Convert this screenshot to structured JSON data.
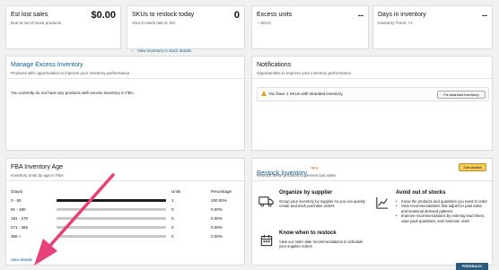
{
  "cards": {
    "lost_sales": {
      "title": "Est lost sales",
      "value": "$0.00",
      "subtitle": "Due to out of stock products"
    },
    "restock": {
      "title": "SKUs to restock today",
      "value": "0",
      "subtitle": "Your in-stock rate is: 0%",
      "link": "View inventory in stock details"
    },
    "excess": {
      "title": "Excess units",
      "value": "--",
      "subtitle": "-- SKUs"
    },
    "days": {
      "title": "Days in inventory",
      "value": "--",
      "subtitle": "Inventory Turns: <1"
    }
  },
  "excess_inventory": {
    "title": "Manage Excess Inventory",
    "subtitle": "Products with opportunities to improve your inventory performance",
    "message": "You currently do not have any products with excess inventory in FBA."
  },
  "notifications": {
    "title": "Notifications",
    "subtitle": "Opportunities to improve your inventory performance",
    "message": "You have 1 SKUs with stranded inventory.",
    "button": "Fix stranded inventory"
  },
  "age": {
    "title": "FBA Inventory Age",
    "subtitle": "Inventory units by age in FBA",
    "headers": {
      "days": "(Days)",
      "units": "Units",
      "pct": "Percentage"
    },
    "rows": [
      {
        "range": "0 - 90",
        "units": "1",
        "pct": "100.00%",
        "fill": 1.0
      },
      {
        "range": "91 - 180",
        "units": "0",
        "pct": "0.00%",
        "fill": 0
      },
      {
        "range": "181 - 270",
        "units": "0",
        "pct": "0.00%",
        "fill": 0
      },
      {
        "range": "271 - 365",
        "units": "0",
        "pct": "0.00%",
        "fill": 0
      },
      {
        "range": "365 +",
        "units": "0",
        "pct": "0.00%",
        "fill": 0
      }
    ],
    "link": "View details"
  },
  "restock_inventory": {
    "title": "Restock Inventory",
    "badge": "NEW",
    "subtitle": "Restock these products to prevent lost sales",
    "button": "Get started",
    "organize": {
      "title": "Organize by supplier",
      "text": "Group your inventory by supplier so you can quickly create and track purchase orders"
    },
    "when": {
      "title": "Know when to restock",
      "text": "View our order date recommendations to schedule your supplier orders"
    },
    "avoid": {
      "title": "Avoid out of stocks",
      "bullets": [
        "Know the products and quantities you need to order",
        "View recommendations that adjust for past sales and seasonal demand patterns",
        "Improve recommendations by entering lead times, case pack quantities, and minimum order"
      ]
    },
    "feedback": "FEEDBACK"
  },
  "colors": {
    "accent_link": "#0f5e8f",
    "arrow": "#e8407a",
    "button_yellow": "#f7ca56"
  }
}
